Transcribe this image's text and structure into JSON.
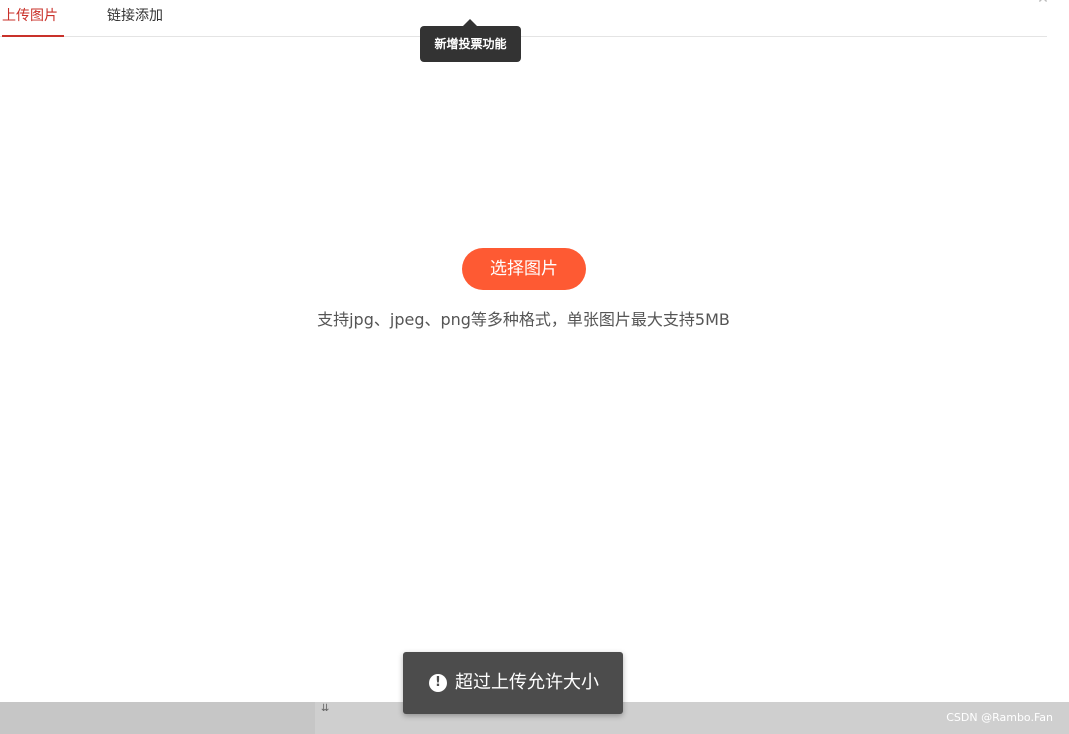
{
  "tabs": [
    {
      "label": "上传图片"
    },
    {
      "label": "链接添加"
    }
  ],
  "tooltip": {
    "text": "新增投票功能"
  },
  "upload": {
    "button_label": "选择图片",
    "hint": "支持jpg、jpeg、png等多种格式，单张图片最大支持5MB"
  },
  "toast": {
    "icon": "exclamation-circle-icon",
    "message": "超过上传允许大小"
  },
  "watermark": "CSDN @Rambo.Fan",
  "colors": {
    "accent": "#c9312a",
    "button": "#fe5a33",
    "tooltip_bg": "#333333",
    "toast_bg": "#4c4c4c"
  }
}
